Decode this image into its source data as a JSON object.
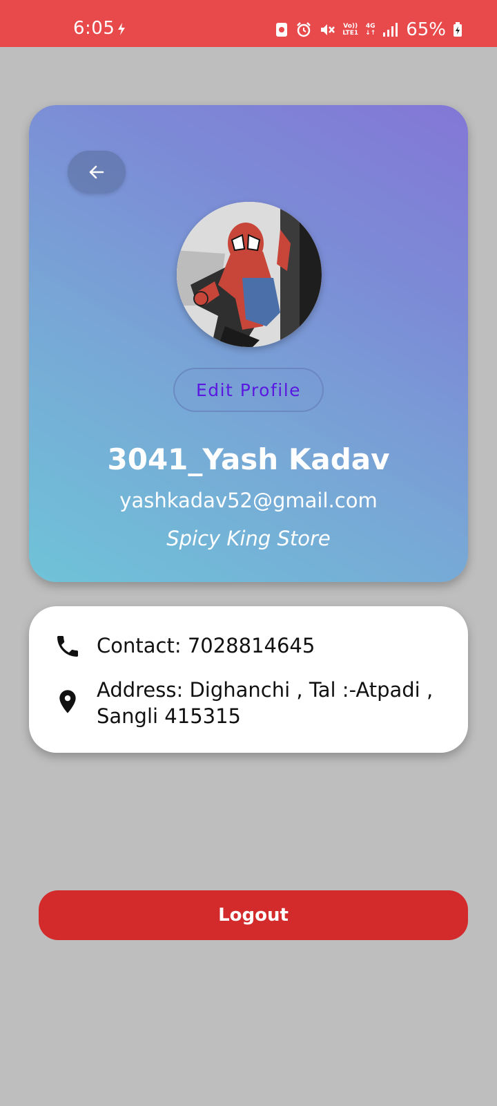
{
  "status_bar": {
    "time": "6:05",
    "volte_top": "Vo))",
    "volte_bottom": "LTE1",
    "network_top": "4G",
    "network_bottom": "↓↑",
    "battery": "65%",
    "battery_level_percent": 65
  },
  "profile": {
    "edit_label": "Edit Profile",
    "name": "3041_Yash Kadav",
    "email": "yashkadav52@gmail.com",
    "store": "Spicy King Store"
  },
  "info": {
    "contact": "Contact: 7028814645",
    "address": "Address: Dighanchi , Tal :-Atpadi , Sangli 415315"
  },
  "actions": {
    "logout_label": "Logout"
  },
  "colors": {
    "status_bar": "#e84a4c",
    "background": "#bebebe",
    "edit_text": "#5a18e0",
    "logout": "#d32b2b"
  },
  "icons": {
    "back": "arrow-left-icon",
    "phone": "phone-icon",
    "location": "location-pin-icon"
  }
}
